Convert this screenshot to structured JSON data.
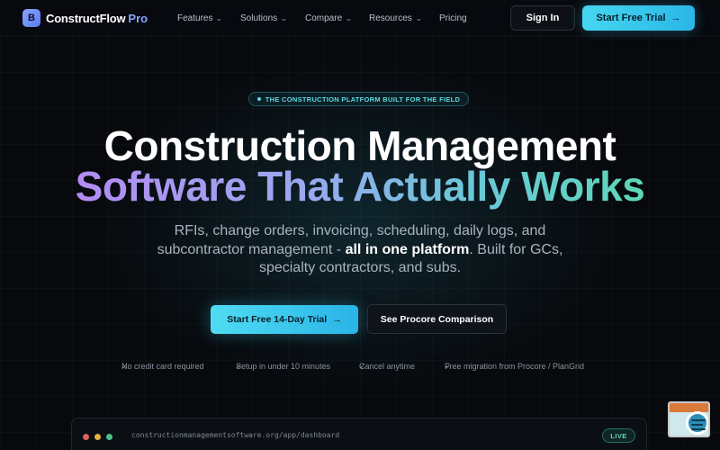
{
  "nav": {
    "logo_letter": "B",
    "brand": "ConstructFlow",
    "brand_suffix": "Pro",
    "items": [
      {
        "label": "Features",
        "dropdown": true
      },
      {
        "label": "Solutions",
        "dropdown": true
      },
      {
        "label": "Compare",
        "dropdown": true
      },
      {
        "label": "Resources",
        "dropdown": true
      },
      {
        "label": "Pricing",
        "dropdown": false
      }
    ],
    "chevron_glyph": "⌄",
    "signin_label": "Sign In",
    "trial_label": "Start Free Trial",
    "arrow_glyph": "→"
  },
  "hero": {
    "badge": "THE CONSTRUCTION PLATFORM BUILT FOR THE FIELD",
    "title_line1": "Construction Management",
    "title_line2": "Software That Actually Works",
    "subtitle_part1": "RFIs, change orders, invoicing, scheduling, daily logs, and subcontractor management - ",
    "subtitle_bold": "all in one platform",
    "subtitle_part2": ". Built for GCs, specialty contractors, and subs.",
    "cta_primary": "Start Free 14-Day Trial",
    "cta_secondary": "See Procore Comparison",
    "check_glyph": "✓",
    "checks": [
      "No credit card required",
      "Setup in under 10 minutes",
      "Cancel anytime",
      "Free migration from Procore / PlanGrid"
    ]
  },
  "preview": {
    "url": "constructionmanagementsoftware.org/app/dashboard",
    "live_label": "LIVE"
  },
  "colors": {
    "accent": "#3cc8f0",
    "gradient_start": "#b38bf2",
    "gradient_end": "#5ed6b6",
    "background": "#07090d"
  },
  "icons": [
    "logo-mark-icon",
    "chevron-down-icon",
    "arrow-right-icon",
    "check-icon",
    "window-dot-icon",
    "chat-widget-icon"
  ]
}
